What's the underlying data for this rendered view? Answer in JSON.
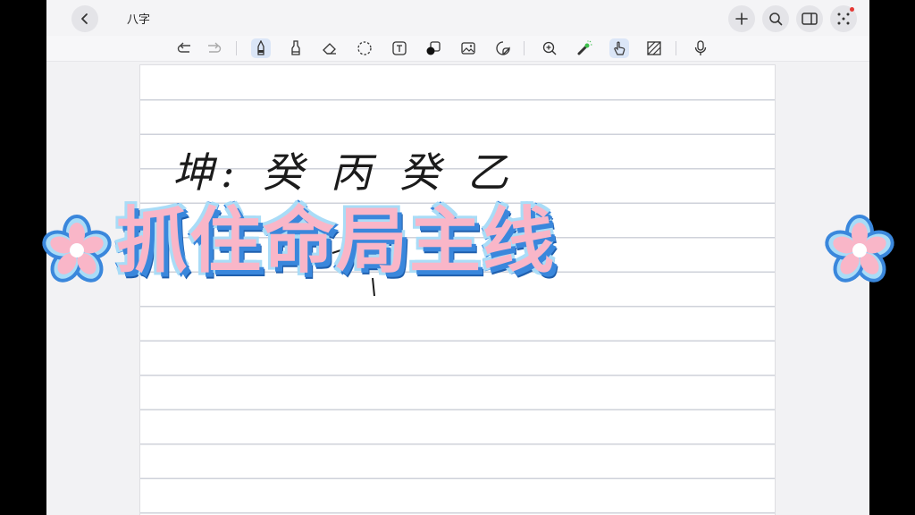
{
  "header": {
    "title": "八字"
  },
  "colors": {
    "banner_fill": "#f9b6c8",
    "banner_outline": "#3a87dc",
    "toolbar_active": "#dbe6f7",
    "notification_dot": "#e53935"
  },
  "toolbar": {
    "tools": [
      "undo-icon",
      "redo-icon",
      "pen-icon",
      "highlighter-icon",
      "eraser-icon",
      "lasso-icon",
      "text-icon",
      "shapes-icon",
      "image-icon",
      "sticker-icon",
      "zoom-icon",
      "laser-icon",
      "touch-draw-icon",
      "pattern-icon",
      "microphone-icon"
    ],
    "active_tools": [
      "pen-icon",
      "touch-draw-icon"
    ]
  },
  "page": {
    "handwriting_line1": "坤: 癸 丙 癸 乙"
  },
  "banner": {
    "text": "抓住命局主线"
  }
}
